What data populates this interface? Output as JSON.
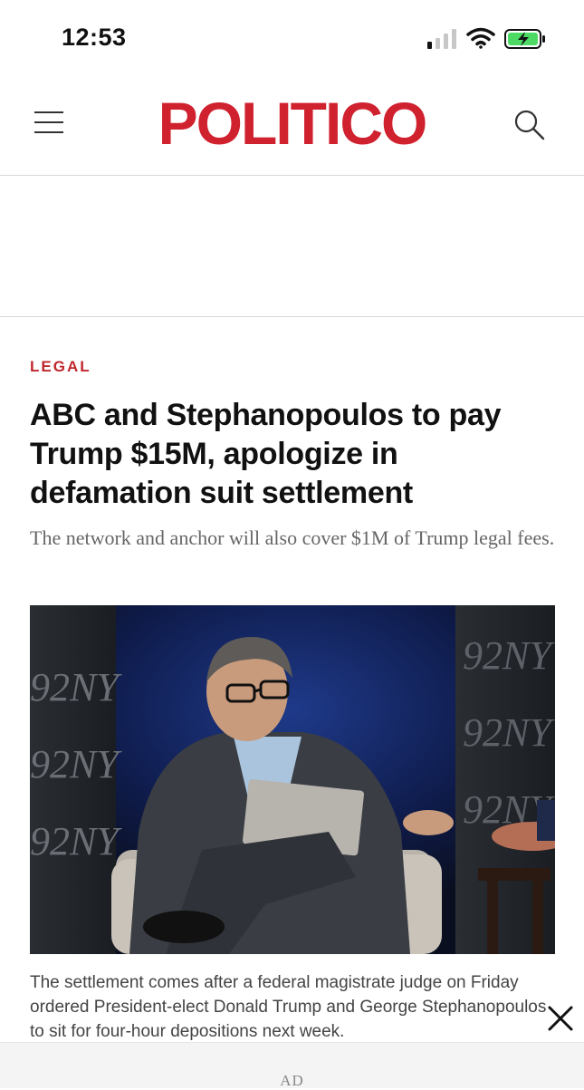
{
  "status_bar": {
    "time": "12:53",
    "signal_icon": "cellular-signal-icon",
    "wifi_icon": "wifi-icon",
    "battery_icon": "battery-charging-icon",
    "battery_color": "#4cd964"
  },
  "header": {
    "logo_text": "POLITICO",
    "brand_color": "#d0212f",
    "menu_icon": "hamburger-menu-icon",
    "search_icon": "search-icon"
  },
  "article": {
    "category": "LEGAL",
    "category_color": "#c0272d",
    "headline": "ABC and Stephanopoulos to pay Trump $15M, apologize in defamation suit settlement",
    "dek": "The network and anchor will also cover $1M of Trump legal fees.",
    "hero_backdrop_text": "92NY",
    "caption": "The settlement comes after a federal magistrate judge on Friday ordered President-elect Donald Trump and George Stephanopoulos to sit for four-hour depositions next week."
  },
  "ad_bar": {
    "label": "AD",
    "close_icon": "close-icon"
  }
}
